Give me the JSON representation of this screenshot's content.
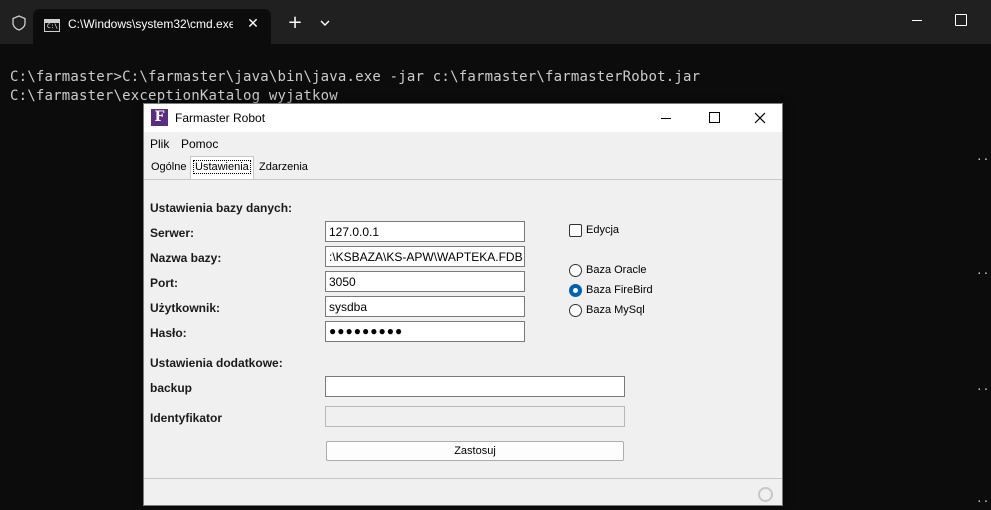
{
  "terminal": {
    "tab_title": "C:\\Windows\\system32\\cmd.exe",
    "lines": [
      "C:\\farmaster>C:\\farmaster\\java\\bin\\java.exe -jar c:\\farmaster\\farmasterRobot.jar",
      "C:\\farmaster\\exceptionKatalog wyjatkow"
    ],
    "dots": [
      "..",
      "..",
      "..",
      ".."
    ]
  },
  "app": {
    "logo": "F",
    "title": "Farmaster Robot",
    "menu": [
      "Plik",
      "Pomoc"
    ],
    "tabs": [
      "Ogólne",
      "Ustawienia",
      "Zdarzenia"
    ],
    "active_tab": "Ustawienia",
    "db_section": "Ustawienia bazy danych:",
    "fields": {
      "server_label": "Serwer:",
      "server_value": "127.0.0.1",
      "dbname_label": "Nazwa bazy:",
      "dbname_value": ":\\KSBAZA\\KS-APW\\WAPTEKA.FDB",
      "port_label": "Port:",
      "port_value": "3050",
      "user_label": "Użytkownik:",
      "user_value": "sysdba",
      "password_label": "Hasło:",
      "password_value": "●●●●●●●●●"
    },
    "edit_checkbox": {
      "label": "Edycja",
      "checked": false
    },
    "db_types": [
      {
        "label": "Baza Oracle",
        "checked": false
      },
      {
        "label": "Baza FireBird",
        "checked": true
      },
      {
        "label": "Baza MySql",
        "checked": false
      }
    ],
    "extra_section": "Ustawienia dodatkowe:",
    "backup_label": "backup",
    "backup_value": "",
    "identifier_label": "Identyfikator",
    "identifier_value": "",
    "apply_button": "Zastosuj"
  }
}
